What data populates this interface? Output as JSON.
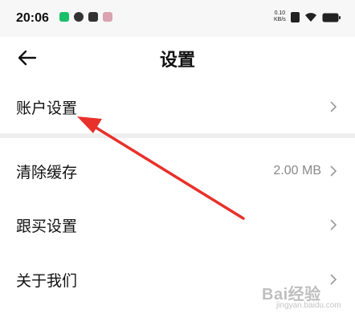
{
  "status_bar": {
    "time": "20:06",
    "net_speed_value": "0.10",
    "net_speed_unit": "KB/s",
    "left_icons": [
      "app-icon-green",
      "notification-icon",
      "mail-icon",
      "avatar-icon"
    ],
    "right_icons": [
      "nfc-icon",
      "wifi-icon",
      "battery-icon"
    ]
  },
  "header": {
    "back_icon": "arrow-left-icon",
    "title": "设置"
  },
  "settings": [
    {
      "label": "账户设置",
      "value": "",
      "icon": "chevron-right-icon"
    },
    {
      "label": "清除缓存",
      "value": "2.00 MB",
      "icon": "chevron-right-icon"
    },
    {
      "label": "跟买设置",
      "value": "",
      "icon": "chevron-right-icon"
    },
    {
      "label": "关于我们",
      "value": "",
      "icon": "chevron-right-icon"
    }
  ],
  "watermark": {
    "text": "Bai经验",
    "sub": "jingyan.baidu.com"
  },
  "colors": {
    "annotation_arrow": "#e8312a",
    "divider": "#eeeeee",
    "value_text": "#8a8a8a"
  }
}
